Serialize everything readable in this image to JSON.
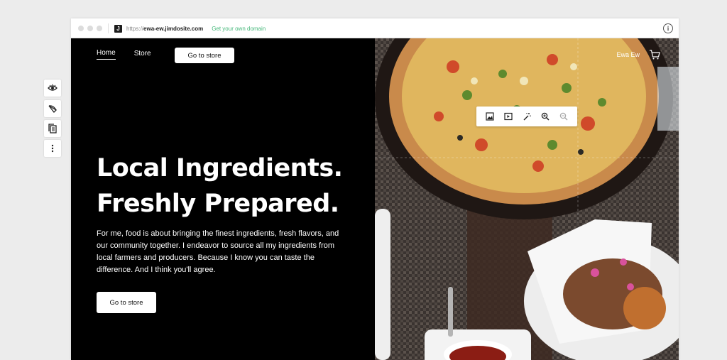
{
  "browser": {
    "url_prefix": "https://",
    "url_domain": "ewa-ew.jimdosite.com",
    "domain_link": "Get your own domain",
    "favicon": "J"
  },
  "nav": {
    "items": [
      {
        "label": "Home",
        "active": true
      },
      {
        "label": "Store",
        "active": false
      }
    ],
    "store_button": "Go to store",
    "user_name": "Ewa Ew"
  },
  "hero": {
    "headline_line1": "Local Ingredients.",
    "headline_line2": "Freshly Prepared.",
    "body": "For me, food is about bringing the finest ingredients, fresh flavors, and our community together. I endeavor to source all my ingredients from local farmers and producers. Because I know you can taste the difference. And I think you'll agree.",
    "button": "Go to store"
  },
  "image_toolbar": {
    "icons": [
      "image-icon",
      "video-icon",
      "magic-wand-icon",
      "zoom-in-icon",
      "zoom-out-icon"
    ]
  },
  "sidebar_tools": {
    "icons": [
      "eye-icon",
      "palette-icon",
      "pages-icon",
      "more-icon"
    ]
  },
  "colors": {
    "hero_bg": "#000000",
    "domain_link": "#45b87a",
    "page_bg": "#ececec"
  }
}
